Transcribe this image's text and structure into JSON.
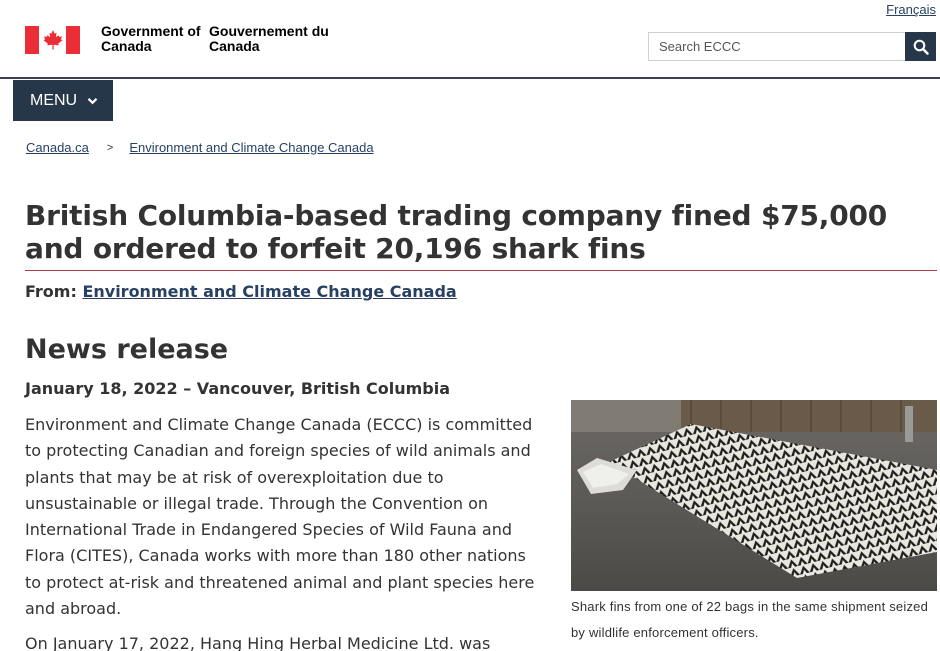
{
  "header": {
    "language_link": "Français",
    "signature_en": "Government of Canada",
    "signature_fr": "Gouvernement du Canada",
    "search_placeholder": "Search ECCC",
    "menu_label": "MENU"
  },
  "breadcrumb": [
    "Canada.ca",
    "Environment and Climate Change Canada"
  ],
  "article": {
    "title": "British Columbia-based trading company fined $75,000 and ordered to forfeit 20,196 shark fins",
    "from_label": "From:",
    "from_link": "Environment and Climate Change Canada",
    "section_heading": "News release",
    "dateline": "January 18, 2022 – Vancouver, British Columbia",
    "paragraphs": [
      "Environment and Climate Change Canada (ECCC) is committed to protecting Canadian and foreign species of wild animals and plants that may be at risk of overexploitation due to unsustainable or illegal trade. Through the Convention on International Trade in Endangered Species of Wild Fauna and Flora (CITES), Canada works with more than 180 other nations to protect at-risk and threatened animal and plant species here and abroad.",
      "On January 17, 2022, Hang Hing Herbal Medicine Ltd. was"
    ],
    "figure_caption": "Shark fins from one of 22 bags in the same shipment seized by wildlife enforcement officers."
  },
  "colors": {
    "nav_dark": "#26374a",
    "link": "#284162",
    "title_rule": "#af3c43",
    "flag_red": "#eb2d37"
  }
}
